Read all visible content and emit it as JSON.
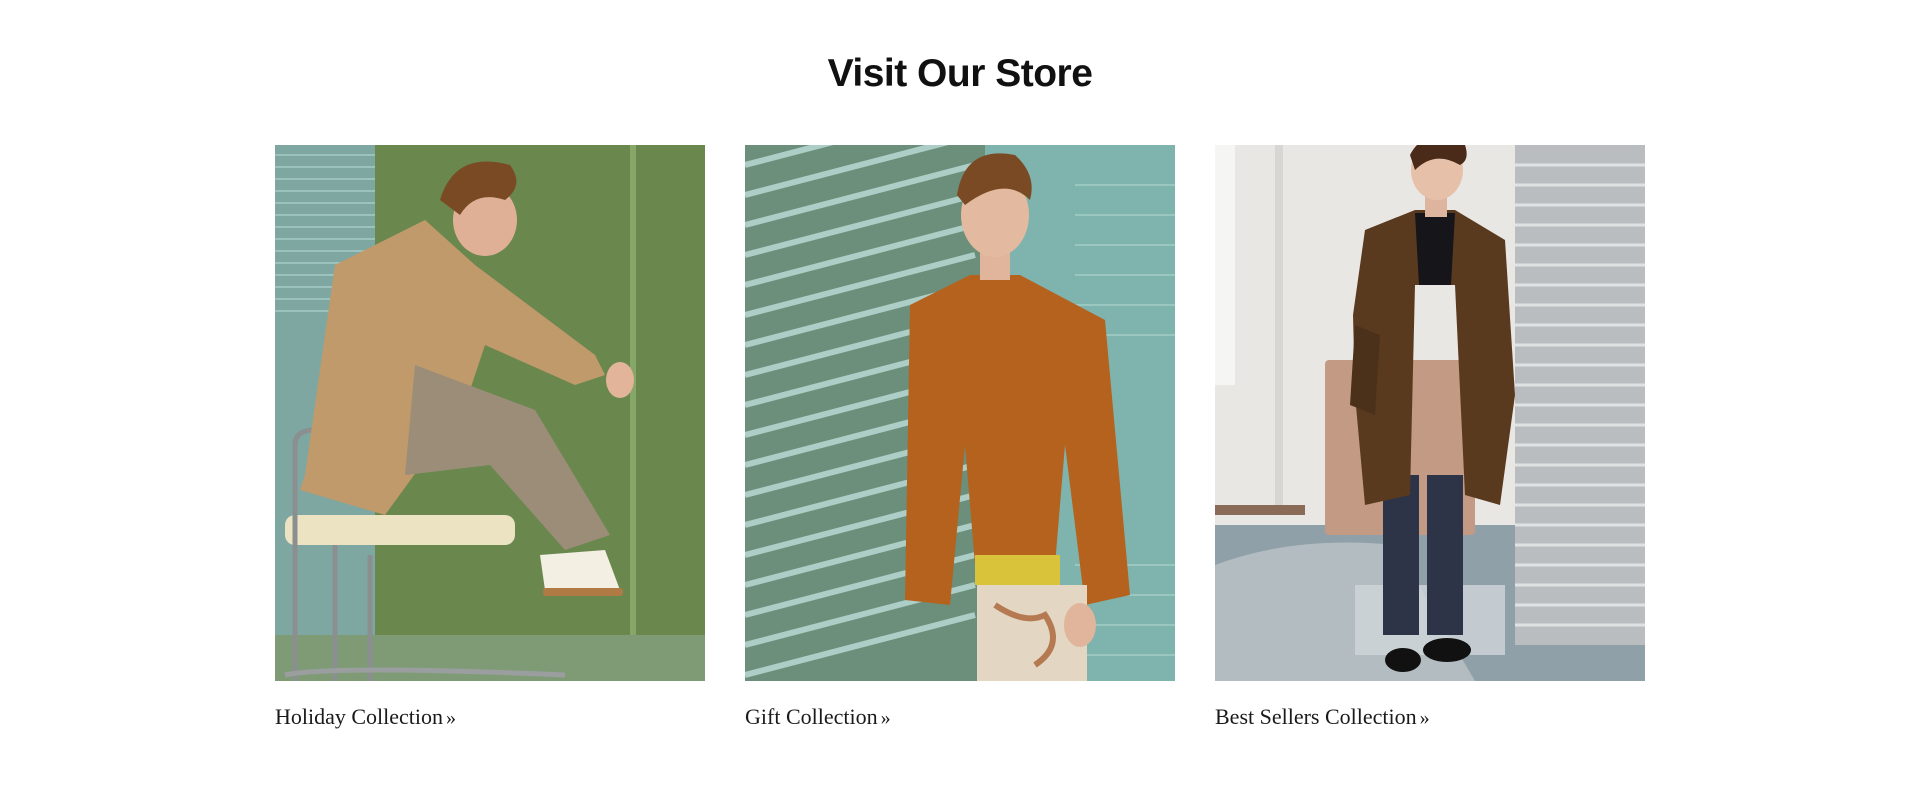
{
  "section": {
    "title": "Visit Our Store"
  },
  "collections": [
    {
      "label": "Holiday Collection",
      "chevron": "»",
      "image_description_icon": "photo-icon"
    },
    {
      "label": "Gift Collection",
      "chevron": "»",
      "image_description_icon": "photo-icon"
    },
    {
      "label": "Best Sellers Collection",
      "chevron": "»",
      "image_description_icon": "photo-icon"
    }
  ],
  "colors": {
    "background": "#ffffff",
    "text": "#111111",
    "photo1_wall": "#6f8d52",
    "photo2_blinds": "#7fb3ad",
    "photo3_wall": "#e9e7e4"
  }
}
